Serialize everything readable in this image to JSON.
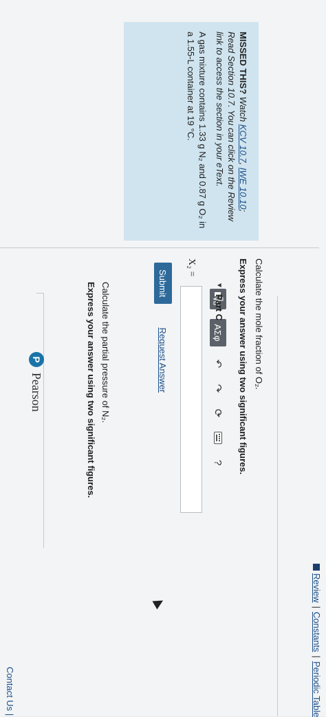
{
  "nav": {
    "review": "Review",
    "constants": "Constants",
    "periodic_table": "Periodic Table",
    "separator": "|"
  },
  "missed": {
    "label": "MISSED THIS?",
    "watch": "Watch",
    "link1": "KCV 10.7",
    "comma": ",",
    "link2": "IWE 10.10",
    "text1": "; Read Section 10.7. You can click on the Review link to access the section in your eText.",
    "problem": "A gas mixture contains 1.33 g N₂ and 0.87 g O₂ in a 1.55-L container at 19 °C."
  },
  "partB": {
    "question": "Calculate the mole fraction of O₂.",
    "instruction": "Express your answer using two significant figures.",
    "toolbar": {
      "greek_label": "ΑΣφ",
      "help_label": "?"
    },
    "answer_label": "X₂ =",
    "answer_value": "",
    "submit_label": "Submit",
    "request_answer_label": "Request Answer"
  },
  "partC": {
    "title": "Part C",
    "question": "Calculate the partial pressure of N₂.",
    "instruction": "Express your answer using two significant figures."
  },
  "footer": {
    "brand": "Pearson",
    "brand_initial": "P",
    "contact": "Contact Us |"
  }
}
